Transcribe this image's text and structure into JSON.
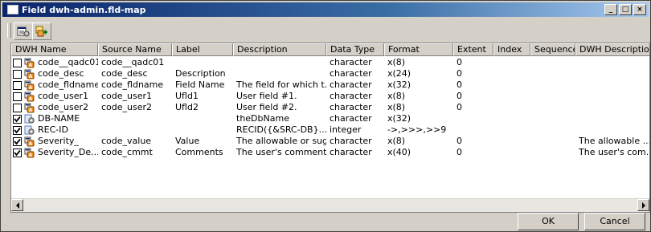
{
  "window": {
    "title": "Field dwh-admin.fld-map"
  },
  "titlebar_buttons": {
    "minimize": "_",
    "maximize": "□",
    "close": "×"
  },
  "toolbar": {
    "icons": [
      "properties-icon",
      "add-field-icon"
    ]
  },
  "columns": [
    "DWH Name",
    "Source Name",
    "Label",
    "Description",
    "Data Type",
    "Format",
    "Extent",
    "Index",
    "Sequence",
    "DWH Description"
  ],
  "rows": [
    {
      "checked": false,
      "icon": "field-icon",
      "dwh_name": "code__qadc01",
      "source_name": "code__qadc01",
      "label": "",
      "description": "",
      "data_type": "character",
      "format": "x(8)",
      "extent": "0",
      "index": "",
      "sequence": "",
      "dwh_description": ""
    },
    {
      "checked": false,
      "icon": "field-icon",
      "dwh_name": "code_desc",
      "source_name": "code_desc",
      "label": "Description",
      "description": "",
      "data_type": "character",
      "format": "x(24)",
      "extent": "0",
      "index": "",
      "sequence": "",
      "dwh_description": ""
    },
    {
      "checked": false,
      "icon": "field-icon",
      "dwh_name": "code_fldname",
      "source_name": "code_fldname",
      "label": "Field Name",
      "description": "The field for which t...",
      "data_type": "character",
      "format": "x(32)",
      "extent": "0",
      "index": "",
      "sequence": "",
      "dwh_description": ""
    },
    {
      "checked": false,
      "icon": "field-icon",
      "dwh_name": "code_user1",
      "source_name": "code_user1",
      "label": "Ufld1",
      "description": "User field #1.",
      "data_type": "character",
      "format": "x(8)",
      "extent": "0",
      "index": "",
      "sequence": "",
      "dwh_description": ""
    },
    {
      "checked": false,
      "icon": "field-icon",
      "dwh_name": "code_user2",
      "source_name": "code_user2",
      "label": "Ufld2",
      "description": "User field #2.",
      "data_type": "character",
      "format": "x(8)",
      "extent": "0",
      "index": "",
      "sequence": "",
      "dwh_description": ""
    },
    {
      "checked": true,
      "icon": "calc-field-icon",
      "dwh_name": "DB-NAME",
      "source_name": "",
      "label": "",
      "description": "theDbName",
      "data_type": "character",
      "format": "x(32)",
      "extent": "",
      "index": "",
      "sequence": "",
      "dwh_description": ""
    },
    {
      "checked": true,
      "icon": "calc-field-icon",
      "dwh_name": "REC-ID",
      "source_name": "",
      "label": "",
      "description": "RECID({&SRC-DB}.....",
      "data_type": "integer",
      "format": "->,>>>,>>9",
      "extent": "",
      "index": "",
      "sequence": "",
      "dwh_description": ""
    },
    {
      "checked": true,
      "icon": "field-icon",
      "dwh_name": "Severity_",
      "source_name": "code_value",
      "label": "Value",
      "description": "The allowable or sug...",
      "data_type": "character",
      "format": "x(8)",
      "extent": "0",
      "index": "",
      "sequence": "",
      "dwh_description": "The allowable ..."
    },
    {
      "checked": true,
      "icon": "field-icon",
      "dwh_name": "Severity_De...",
      "source_name": "code_cmmt",
      "label": "Comments",
      "description": "The user's comment...",
      "data_type": "character",
      "format": "x(40)",
      "extent": "0",
      "index": "",
      "sequence": "",
      "dwh_description": "The user's com..."
    }
  ],
  "buttons": {
    "ok": "OK",
    "cancel": "Cancel"
  }
}
